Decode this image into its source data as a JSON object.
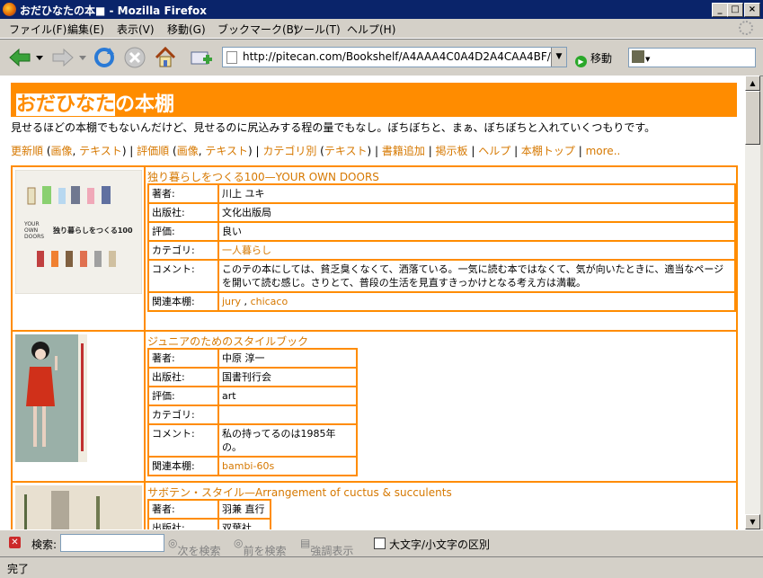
{
  "window": {
    "title": "おだひなたの本■ - Mozilla Firefox",
    "min": "_",
    "max": "□",
    "close": "×"
  },
  "menu": [
    "ファイル(F)",
    "編集(E)",
    "表示(V)",
    "移動(G)",
    "ブックマーク(B)",
    "ツール(T)",
    "ヘルプ(H)"
  ],
  "toolbar": {
    "url": "http://pitecan.com/Bookshelf/A4AAA4C0A4D2A4CAA4BF/",
    "go_label": "移動"
  },
  "page": {
    "title_hl": "おだひなた",
    "title_rest": "の本棚",
    "description": "見せるほどの本棚でもないんだけど、見せるのに尻込みする程の量でもなし。ぼちぼちと、まぁ、ぼちぼちと入れていくつもりです。",
    "nav": [
      {
        "text": "更新順",
        "link": true
      },
      {
        "text": " (",
        "link": false
      },
      {
        "text": "画像",
        "link": true
      },
      {
        "text": ", ",
        "link": false
      },
      {
        "text": "テキスト",
        "link": true
      },
      {
        "text": ") | ",
        "link": false
      },
      {
        "text": "評価順",
        "link": true
      },
      {
        "text": " (",
        "link": false
      },
      {
        "text": "画像",
        "link": true
      },
      {
        "text": ", ",
        "link": false
      },
      {
        "text": "テキスト",
        "link": true
      },
      {
        "text": ") | ",
        "link": false
      },
      {
        "text": "カテゴリ別",
        "link": true
      },
      {
        "text": " (",
        "link": false
      },
      {
        "text": "テキスト",
        "link": true
      },
      {
        "text": ") | ",
        "link": false
      },
      {
        "text": "書籍追加",
        "link": true
      },
      {
        "text": " | ",
        "link": false
      },
      {
        "text": "掲示板",
        "link": true
      },
      {
        "text": " | ",
        "link": false
      },
      {
        "text": "ヘルプ",
        "link": true
      },
      {
        "text": " | ",
        "link": false
      },
      {
        "text": "本棚トップ",
        "link": true
      },
      {
        "text": " | ",
        "link": false
      },
      {
        "text": "more..",
        "link": true
      }
    ]
  },
  "labels": {
    "author": "著者:",
    "publisher": "出版社:",
    "rating": "評価:",
    "category": "カテゴリ:",
    "comment": "コメント:",
    "related": "関連本棚:"
  },
  "books": [
    {
      "title": "独り暮らしをつくる100—YOUR OWN DOORS",
      "author": "川上 ユキ",
      "publisher": "文化出版局",
      "rating": "良い",
      "category": "一人暮らし",
      "comment": "このテの本にしては、貧乏臭くなくて、洒落ている。一気に読む本ではなくて、気が向いたときに、適当なページを開いて読む感じ。さりとて、普段の生活を見直すきっかけとなる考え方は満載。",
      "related": [
        "jury",
        "chicaco"
      ]
    },
    {
      "title": "ジュニアのためのスタイルブック",
      "author": "中原 淳一",
      "publisher": "国書刊行会",
      "rating": "art",
      "category": "",
      "comment": "私の持ってるのは1985年の。",
      "related": [
        "bambi-60s"
      ]
    },
    {
      "title": "サボテン・スタイル—Arrangement of cuctus & succulents",
      "author": "羽兼 直行",
      "publisher": "双葉社"
    }
  ],
  "cover1": {
    "line1": "YOUR",
    "line2": "OWN",
    "line3": "DOORS",
    "jp": "独り暮らしをつくる100"
  },
  "findbar": {
    "label": "検索:",
    "next": "次を検索",
    "prev": "前を検索",
    "highlight": "強調表示",
    "case": "大文字/小文字の区別"
  },
  "status": "完了"
}
